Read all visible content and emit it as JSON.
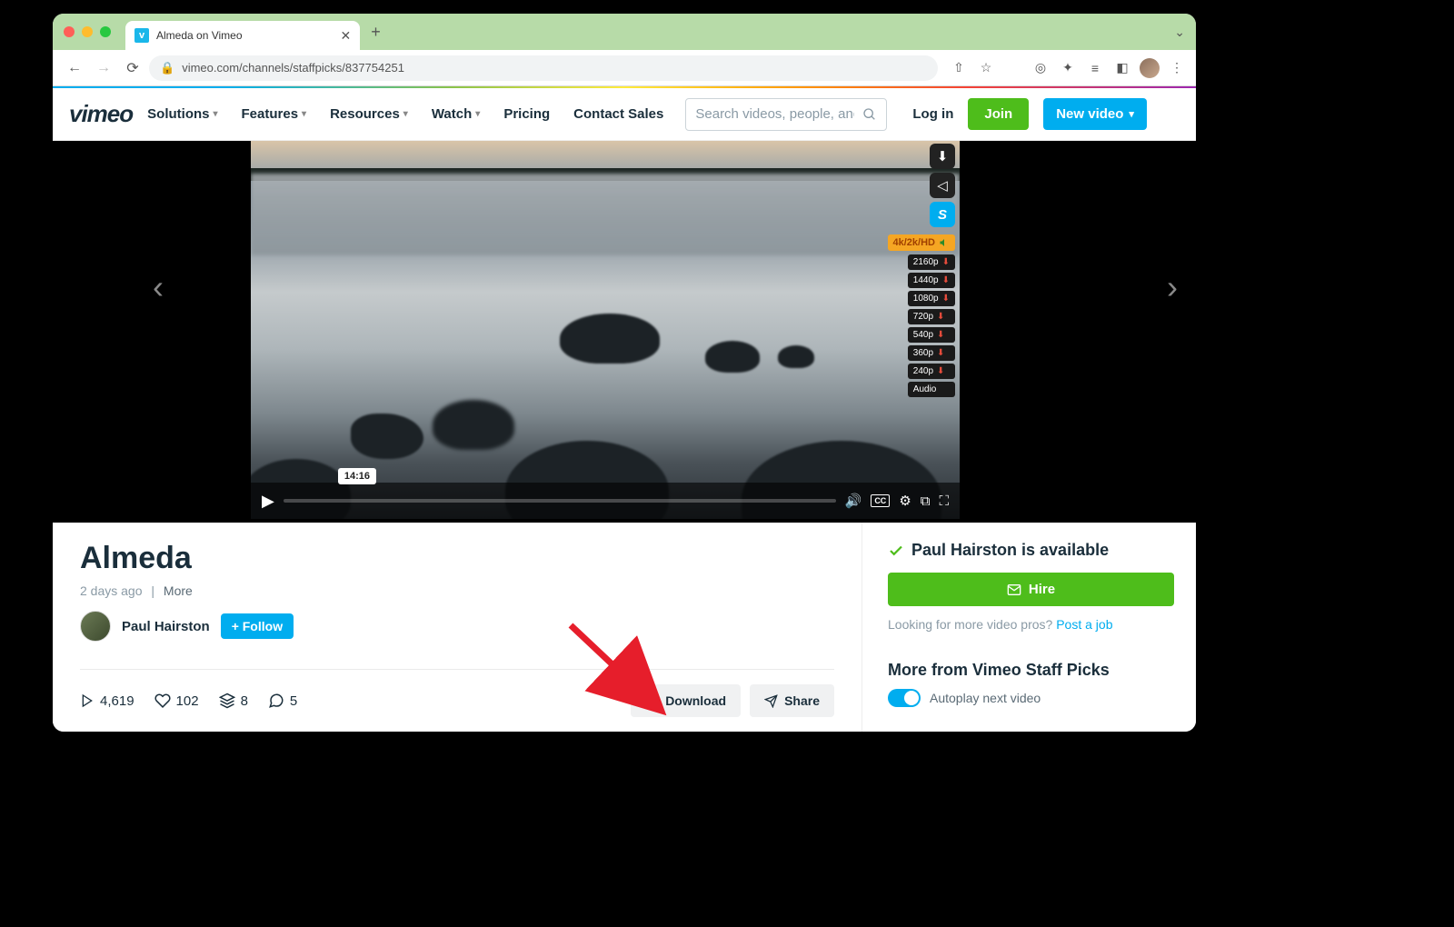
{
  "browser": {
    "tab_title": "Almeda on Vimeo",
    "url": "vimeo.com/channels/staffpicks/837754251"
  },
  "header": {
    "logo": "vimeo",
    "nav": [
      "Solutions",
      "Features",
      "Resources",
      "Watch",
      "Pricing",
      "Contact Sales"
    ],
    "search_placeholder": "Search videos, people, and more",
    "login": "Log in",
    "join": "Join",
    "new_video": "New video"
  },
  "player": {
    "quality_badge": "4k/2k/HD",
    "qualities": [
      "2160p",
      "1440p",
      "1080p",
      "720p",
      "540p",
      "360p",
      "240p",
      "Audio"
    ],
    "tooltip_time": "14:16"
  },
  "video": {
    "title": "Almeda",
    "age": "2 days ago",
    "more": "More",
    "author": "Paul Hairston",
    "follow": "+ Follow"
  },
  "stats": {
    "plays": "4,619",
    "likes": "102",
    "collections": "8",
    "comments": "5"
  },
  "actions": {
    "download": "Download",
    "share": "Share"
  },
  "sidebar": {
    "available": "Paul Hairston is available",
    "hire": "Hire",
    "looking_prefix": "Looking for more video pros? ",
    "post_job": "Post a job",
    "more_from": "More from Vimeo Staff Picks",
    "autoplay": "Autoplay next video"
  }
}
